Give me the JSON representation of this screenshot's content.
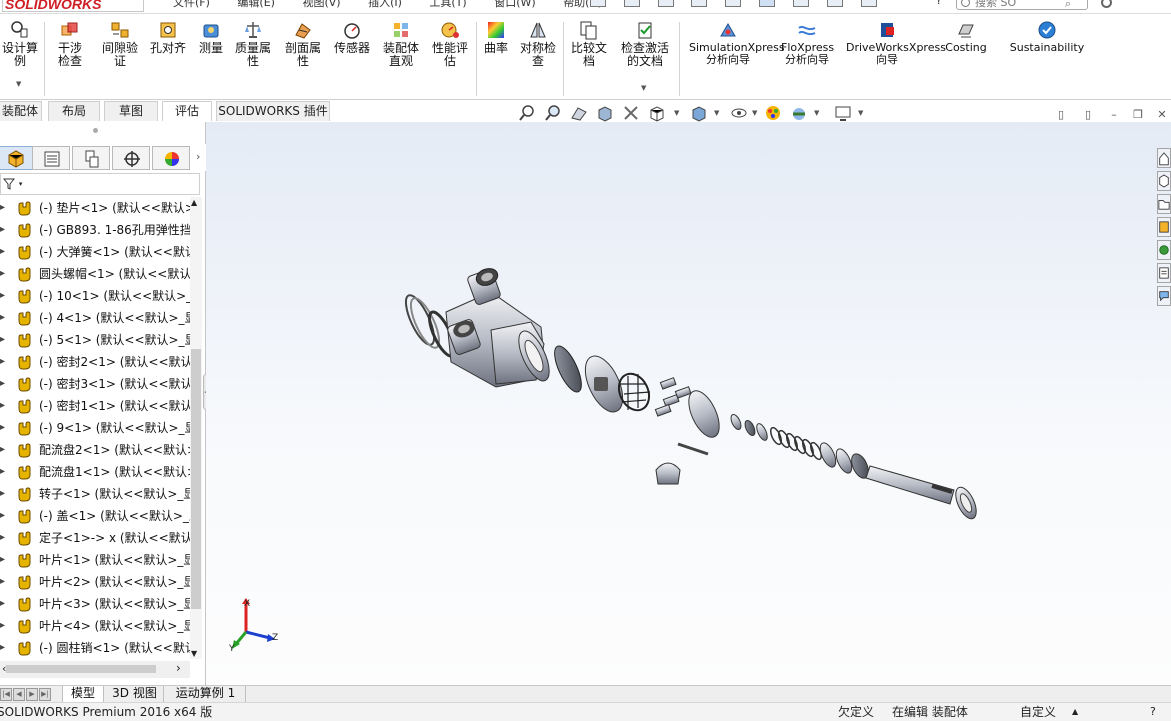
{
  "app": {
    "logo_text": "SOLIDWORKS",
    "menus": [
      "文件(F)",
      "编辑(E)",
      "视图(V)",
      "插入(I)",
      "工具(T)",
      "窗口(W)",
      "帮助(H)"
    ],
    "search_placeholder": "搜索 SO",
    "help_char": "?"
  },
  "ribbon": {
    "buttons": [
      {
        "label": "设计算例",
        "name": "design-study"
      },
      {
        "label": "干涉检查",
        "name": "interference-detection"
      },
      {
        "label": "间隙验证",
        "name": "clearance-verification"
      },
      {
        "label": "孔对齐",
        "name": "hole-alignment"
      },
      {
        "label": "测量",
        "name": "measure"
      },
      {
        "label": "质量属性",
        "name": "mass-properties"
      },
      {
        "label": "剖面属性",
        "name": "section-properties"
      },
      {
        "label": "传感器",
        "name": "sensor"
      },
      {
        "label": "装配体直观",
        "name": "assembly-visualization"
      },
      {
        "label": "性能评估",
        "name": "performance-evaluation"
      },
      {
        "label": "曲率",
        "name": "curvature"
      },
      {
        "label": "对称检查",
        "name": "symmetry-check"
      },
      {
        "label": "比较文档",
        "name": "compare-documents"
      },
      {
        "label": "检查激活的文档",
        "name": "check-active-document"
      },
      {
        "label": "SimulationXpress分析向导",
        "name": "simulationxpress"
      },
      {
        "label": "FloXpress分析向导",
        "name": "floxpress"
      },
      {
        "label": "DriveWorksXpress向导",
        "name": "driveworksxpress"
      },
      {
        "label": "Costing",
        "name": "costing"
      },
      {
        "label": "Sustainability",
        "name": "sustainability"
      }
    ]
  },
  "command_tabs": [
    "装配体",
    "布局",
    "草图",
    "评估",
    "SOLIDWORKS 插件"
  ],
  "active_command_tab": "评估",
  "feature_tree": {
    "filter_label": "▾",
    "items": [
      "(-) 垫片<1> (默认<<默认>_",
      "(-) GB893. 1-86孔用弹性挡",
      "(-) 大弹簧<1> (默认<<默认>",
      "圆头螺帽<1> (默认<<默认>_",
      "(-) 10<1> (默认<<默认>_显",
      "(-) 4<1> (默认<<默认>_显",
      "(-) 5<1> (默认<<默认>_显",
      "(-) 密封2<1> (默认<<默认>",
      "(-) 密封3<1> (默认<<默认>",
      "(-) 密封1<1> (默认<<默认>",
      "(-) 9<1> (默认<<默认>_显",
      "配流盘2<1> (默认<<默认>_",
      "配流盘1<1> (默认<<默认>_",
      "转子<1> (默认<<默认>_显",
      "(-) 盖<1> (默认<<默认>_显",
      "定子<1>-> x (默认<<默认>",
      "叶片<1> (默认<<默认>_显",
      "叶片<2> (默认<<默认>_显",
      "叶片<3> (默认<<默认>_显",
      "叶片<4> (默认<<默认>_显",
      "(-) 圆柱销<1> (默认<<默认>"
    ]
  },
  "triad": {
    "x": "X",
    "y": "Y",
    "z": "Z"
  },
  "bottom_tabs": [
    "模型",
    "3D 视图",
    "运动算例 1"
  ],
  "status": {
    "product": "SOLIDWORKS Premium 2016 x64 版",
    "definition": "欠定义",
    "editing": "在编辑 装配体",
    "units": "自定义",
    "units_arrow": "▲"
  },
  "colors": {
    "brand_red": "#cf1f25",
    "part_yellow": "#e5b400",
    "viewport_top": "#e4ebf5"
  }
}
